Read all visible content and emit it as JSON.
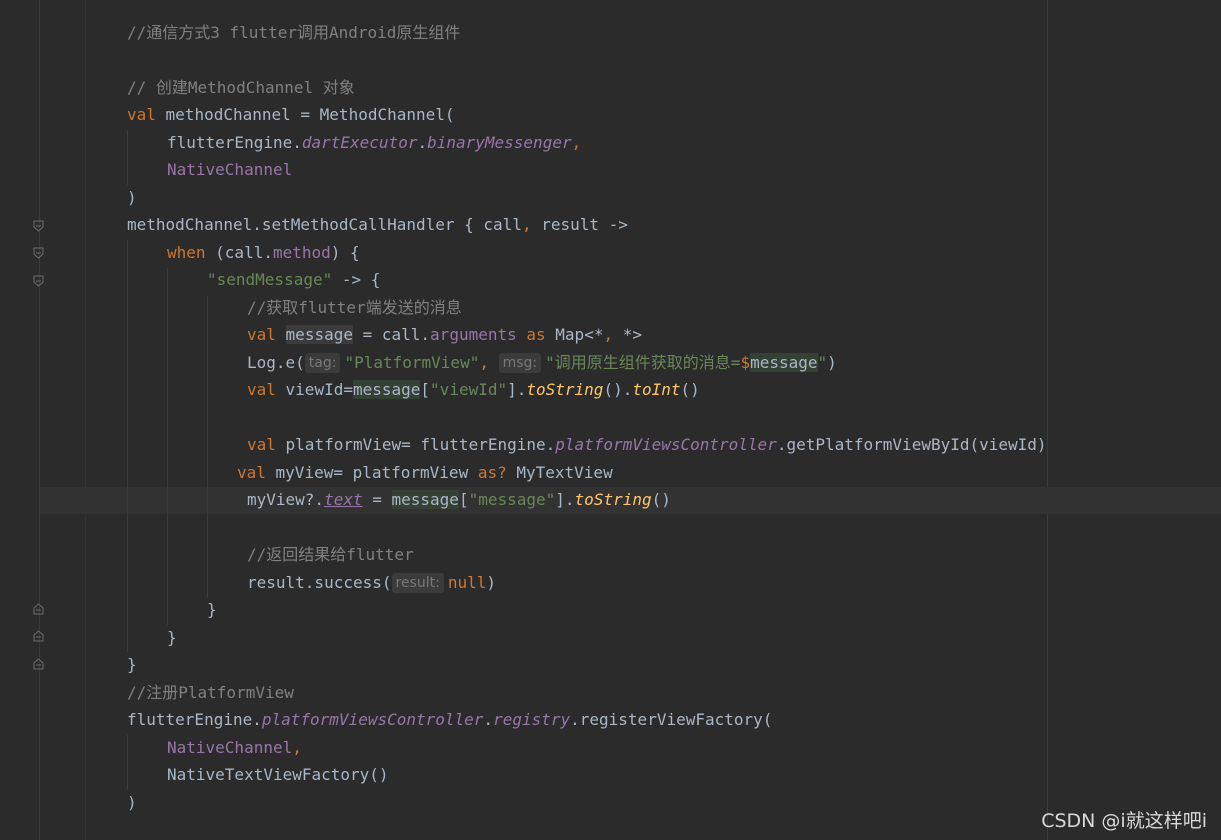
{
  "code": {
    "l1_comment": "//通信方式3 flutter调用Android原生组件",
    "l2_comment": "// 创建MethodChannel 对象",
    "l3_val": "val",
    "l3_rest": " methodChannel = MethodChannel(",
    "l4_a": "flutterEngine.",
    "l4_b": "dartExecutor",
    "l4_c": ".",
    "l4_d": "binaryMessenger",
    "l4_e": ",",
    "l5": "NativeChannel",
    "l6": ")",
    "l7_a": "methodChannel.setMethodCallHandler { call",
    "l7_b": ",",
    "l7_c": " result ->",
    "l8_when": "when",
    "l8_a": " (call.",
    "l8_method": "method",
    "l8_b": ") {",
    "l9_str": "\"sendMessage\"",
    "l9_rest": " -> {",
    "l10_comment": "//获取flutter端发送的消息",
    "l11_val": "val",
    "l11_msg": "message",
    "l11_a": " = call.",
    "l11_args": "arguments",
    "l11_as": "as",
    "l11_b": " Map<*",
    "l11_comma": ",",
    "l11_c": " *>",
    "l12_a": "Log.e(",
    "l12_tag_hint": "tag:",
    "l12_tag_val": "\"PlatformView\"",
    "l12_comma": ",",
    "l12_msg_hint": "msg:",
    "l12_str": "\"调用原生组件获取的消息=",
    "l12_dollar": "$",
    "l12_msg": "message",
    "l12_strend": "\"",
    "l12_end": ")",
    "l13_val": "val",
    "l13_a": " viewId=",
    "l13_msg": "message",
    "l13_b": "[",
    "l13_str": "\"viewId\"",
    "l13_c": "].",
    "l13_fn1": "toString",
    "l13_d": "().",
    "l13_fn2": "toInt",
    "l13_e": "()",
    "l14_val": "val",
    "l14_a": " platformView= flutterEngine.",
    "l14_prop": "platformViewsController",
    "l14_b": ".getPlatformViewById(viewId)",
    "l15_val": "val",
    "l15_a": " myView= platformView ",
    "l15_as": "as?",
    "l15_b": " MyTextView",
    "l16_a": "myView?.",
    "l16_text": "text",
    "l16_b": " = ",
    "l16_msg": "message",
    "l16_c": "[",
    "l16_str": "\"message\"",
    "l16_d": "].",
    "l16_fn": "toString",
    "l16_e": "()",
    "l17_comment": "//返回结果给flutter",
    "l18_a": "result.success(",
    "l18_hint": "result:",
    "l18_null": "null",
    "l18_b": ")",
    "l19": "}",
    "l20": "}",
    "l21": "}",
    "l22_comment": "//注册PlatformView",
    "l23_a": "flutterEngine.",
    "l23_prop1": "platformViewsController",
    "l23_b": ".",
    "l23_prop2": "registry",
    "l23_c": ".registerViewFactory(",
    "l24_a": "NativeChannel",
    "l24_b": ",",
    "l25": "NativeTextViewFactory()",
    "l26": ")"
  },
  "watermark": "CSDN @i就这样吧i",
  "colors": {
    "background": "#2b2b2b",
    "keyword": "#cc7832",
    "comment": "#808080",
    "string": "#6a8759",
    "property": "#9876aa",
    "function": "#ffc66d",
    "text": "#a9b7c6"
  }
}
